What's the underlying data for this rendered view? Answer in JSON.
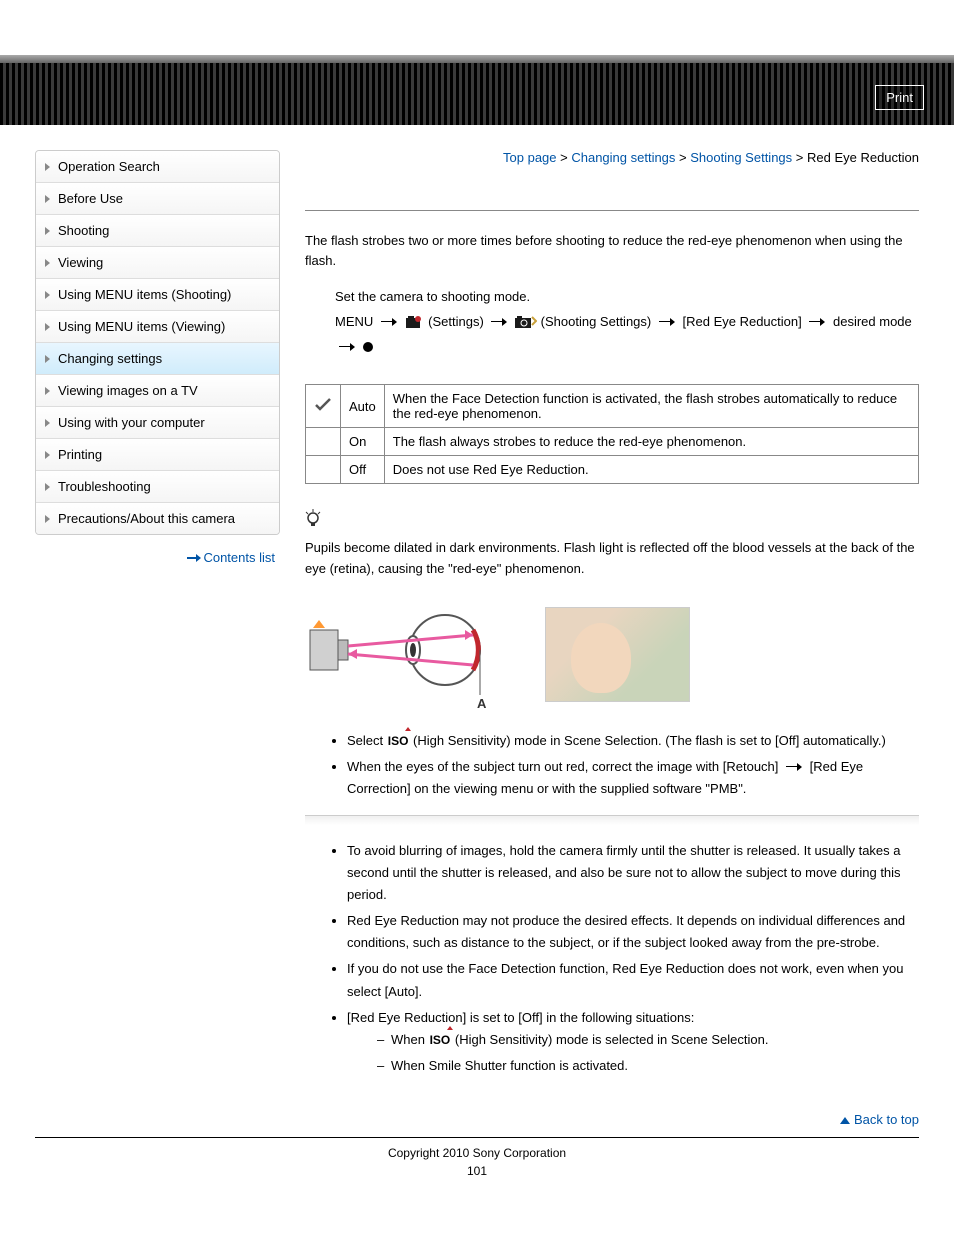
{
  "print_label": "Print",
  "breadcrumb": {
    "items": [
      "Top page",
      "Changing settings",
      "Shooting Settings",
      "Red Eye Reduction"
    ],
    "sep": " > "
  },
  "sidebar": {
    "items": [
      "Operation Search",
      "Before Use",
      "Shooting",
      "Viewing",
      "Using MENU items (Shooting)",
      "Using MENU items (Viewing)",
      "Changing settings",
      "Viewing images on a TV",
      "Using with your computer",
      "Printing",
      "Troubleshooting",
      "Precautions/About this camera"
    ],
    "active_index": 6,
    "contents_list_label": "Contents list"
  },
  "intro": "The flash strobes two or more times before shooting to reduce the red-eye phenomenon when using the flash.",
  "step1": "Set the camera to shooting mode.",
  "step2": {
    "menu": "MENU",
    "settings": "(Settings)",
    "shooting_settings": "(Shooting Settings)",
    "red_eye": "[Red Eye Reduction]",
    "desired": "desired mode"
  },
  "modes": [
    {
      "name": "Auto",
      "desc": "When the Face Detection function is activated, the flash strobes automatically to reduce the red-eye phenomenon."
    },
    {
      "name": "On",
      "desc": "The flash always strobes to reduce the red-eye phenomenon."
    },
    {
      "name": "Off",
      "desc": "Does not use Red Eye Reduction."
    }
  ],
  "tip": {
    "text_before": "Pupils become dilated in dark environments. Flash light is reflected off the blood vessels at the back of the eye (retina)",
    "text_after": ", causing the \"red-eye\" phenomenon.",
    "diagram_label": "A"
  },
  "other_techniques": [
    "Select (High Sensitivity) mode in Scene Selection. (The flash is set to [Off] automatically.)",
    "When the eyes of the subject turn out red, correct the image with [Retouch]  [Red Eye Correction] on the viewing menu or with the supplied software \"PMB\"."
  ],
  "notes": [
    "To avoid blurring of images, hold the camera firmly until the shutter is released. It usually takes a second until the shutter is released, and also be sure not to allow the subject to move during this period.",
    "Red Eye Reduction may not produce the desired effects. It depends on individual differences and conditions, such as distance to the subject, or if the subject looked away from the pre-strobe.",
    "If you do not use the Face Detection function, Red Eye Reduction does not work, even when you select [Auto].",
    "[Red Eye Reduction] is set to [Off] in the following situations:"
  ],
  "subnotes": [
    "When (High Sensitivity) mode is selected in Scene Selection.",
    "When Smile Shutter function is activated."
  ],
  "back_to_top": "Back to top",
  "copyright": "Copyright 2010 Sony Corporation",
  "page_number": "101"
}
